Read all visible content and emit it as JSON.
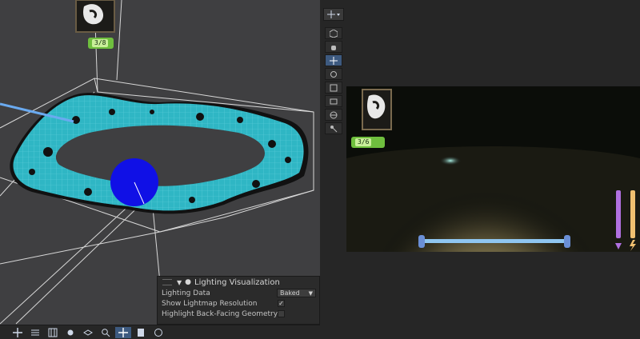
{
  "scene_view": {
    "tools": [
      "move-tool",
      "view-tool",
      "move-arrows-tool",
      "rotate-tool",
      "scale-tool",
      "rect-tool",
      "transform-tool",
      "custom-tool"
    ],
    "bottom_tools": [
      "move-tool",
      "grid-tool",
      "snap-tool",
      "debug-tool",
      "layer-tool",
      "search-tool",
      "move-tool",
      "render-tool",
      "camera-tool"
    ],
    "counter": "3/8"
  },
  "overlay_panel": {
    "title": "Lighting Visualization",
    "rows": {
      "lighting_data_label": "Lighting Data",
      "lighting_data_value": "Baked",
      "show_lightmap_label": "Show Lightmap Resolution",
      "show_lightmap_checked": "✓",
      "highlight_backfacing_label": "Highlight Back-Facing Geometry"
    }
  },
  "game_view": {
    "counter": "3/6",
    "health_color": "#b070e0",
    "stamina_color": "#f0c070"
  },
  "colors": {
    "accent": "#3d5a80",
    "mesh": "#2fb6c4",
    "sphere": "#1010e6"
  }
}
